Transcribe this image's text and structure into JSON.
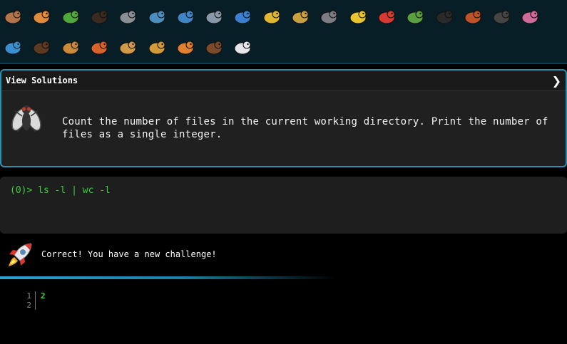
{
  "icon_bar": {
    "icons": [
      {
        "name": "snail-icon",
        "color": "#b3744a"
      },
      {
        "name": "butterfly-icon",
        "color": "#e08a3c"
      },
      {
        "name": "caterpillar-icon",
        "color": "#4fa83a"
      },
      {
        "name": "ant-icon",
        "color": "#3a2a20"
      },
      {
        "name": "spiderweb-icon",
        "color": "#8a8f96"
      },
      {
        "name": "whale-icon",
        "color": "#4a8fc0"
      },
      {
        "name": "dolphin-icon",
        "color": "#3f86c6"
      },
      {
        "name": "dolphin-grey-icon",
        "color": "#8a99a8"
      },
      {
        "name": "fish-icon",
        "color": "#3a7fd0"
      },
      {
        "name": "angelfish-icon",
        "color": "#e0b830"
      },
      {
        "name": "pufferfish-icon",
        "color": "#c9a040"
      },
      {
        "name": "wolf-icon",
        "color": "#7c7c84"
      },
      {
        "name": "bee-icon",
        "color": "#e8c430"
      },
      {
        "name": "ladybug-icon",
        "color": "#d63a30"
      },
      {
        "name": "worm-icon",
        "color": "#5aa040"
      },
      {
        "name": "spider-icon",
        "color": "#2a2a2a"
      },
      {
        "name": "scorpion-icon",
        "color": "#c0522a"
      },
      {
        "name": "fly-icon",
        "color": "#444444"
      },
      {
        "name": "earthworm-icon",
        "color": "#d06a9a"
      },
      {
        "name": "bacteria-icon",
        "color": "#3a8fd0"
      },
      {
        "name": "chimpanzee-icon",
        "color": "#5a3a22"
      },
      {
        "name": "dog-icon",
        "color": "#c98a3a"
      },
      {
        "name": "fox-icon",
        "color": "#d8622a"
      },
      {
        "name": "cat-icon",
        "color": "#d09a48"
      },
      {
        "name": "lion-icon",
        "color": "#d29a38"
      },
      {
        "name": "tiger-icon",
        "color": "#e08030"
      },
      {
        "name": "horse-icon",
        "color": "#7a4a2a"
      },
      {
        "name": "unicorn-icon",
        "color": "#e6e6ee"
      }
    ]
  },
  "panel": {
    "title": "View Solutions",
    "chevron": "❯",
    "challenge": "Count the number of files in the current working directory. Print the number of files as a single integer."
  },
  "terminal": {
    "prompt": "(0)>",
    "command": "ls -l | wc -l"
  },
  "status": {
    "message": "Correct! You have a new challenge!"
  },
  "output": {
    "lines": [
      {
        "num": "1",
        "text": "2"
      },
      {
        "num": "2",
        "text": ""
      }
    ]
  }
}
